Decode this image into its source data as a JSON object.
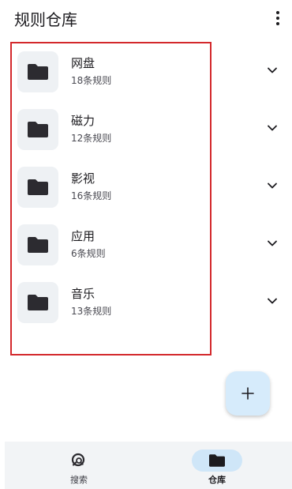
{
  "app_bar": {
    "title": "规则仓库",
    "overflow_icon": "more-vert-icon"
  },
  "repositories": [
    {
      "name": "网盘",
      "count": "18条规则",
      "icon": "folder-icon"
    },
    {
      "name": "磁力",
      "count": "12条规则",
      "icon": "folder-icon"
    },
    {
      "name": "影视",
      "count": "16条规则",
      "icon": "folder-icon"
    },
    {
      "name": "应用",
      "count": "6条规则",
      "icon": "folder-icon"
    },
    {
      "name": "音乐",
      "count": "13条规则",
      "icon": "folder-icon"
    }
  ],
  "fab": {
    "icon": "plus-icon"
  },
  "bottom_nav": {
    "items": [
      {
        "label": "搜索",
        "icon": "search-icon",
        "selected": false
      },
      {
        "label": "仓库",
        "icon": "folder-icon",
        "selected": true
      }
    ]
  },
  "colors": {
    "highlight_border": "#d3282c",
    "fab_background": "#d6ebfb",
    "selected_nav_pill": "#cfe6f8",
    "icon_box": "#eef1f4"
  }
}
